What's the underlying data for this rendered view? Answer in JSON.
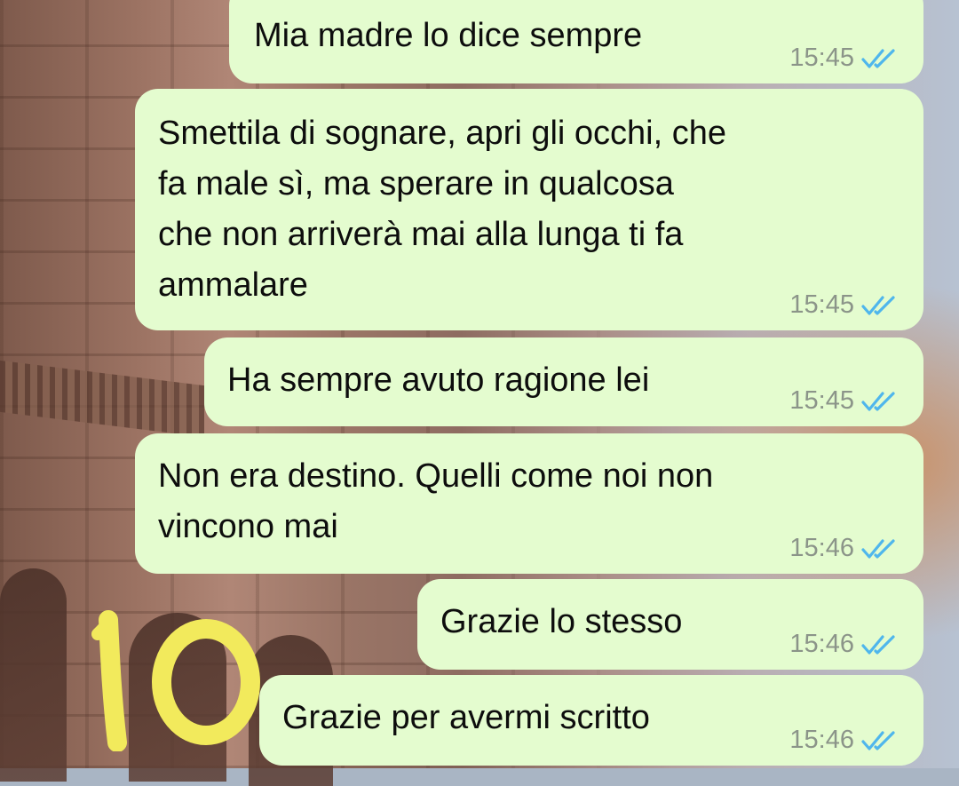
{
  "chat": {
    "messages": [
      {
        "text": "Mia madre lo dice sempre",
        "time": "15:45",
        "status": "read",
        "status_icon": "double-check-icon"
      },
      {
        "text": "Smettila di sognare, apri gli occhi, che\nfa male sì, ma sperare in qualcosa\nche non arriverà mai alla lunga ti fa\nammalare",
        "time": "15:45",
        "status": "read",
        "status_icon": "double-check-icon"
      },
      {
        "text": "Ha sempre avuto ragione lei",
        "time": "15:45",
        "status": "read",
        "status_icon": "double-check-icon"
      },
      {
        "text": "Non era destino. Quelli come noi non\nvincono mai",
        "time": "15:46",
        "status": "read",
        "status_icon": "double-check-icon"
      },
      {
        "text": "Grazie lo stesso",
        "time": "15:46",
        "status": "read",
        "status_icon": "double-check-icon"
      },
      {
        "text": "Grazie per avermi scritto",
        "time": "15:46",
        "status": "read",
        "status_icon": "double-check-icon"
      }
    ]
  },
  "annotation": {
    "label": "10",
    "color": "#f2ea5c"
  },
  "colors": {
    "bubble_background": "#e4fccf",
    "message_text": "#0d0d0d",
    "timestamp": "#8b9489",
    "read_ticks": "#4fb6ec"
  }
}
